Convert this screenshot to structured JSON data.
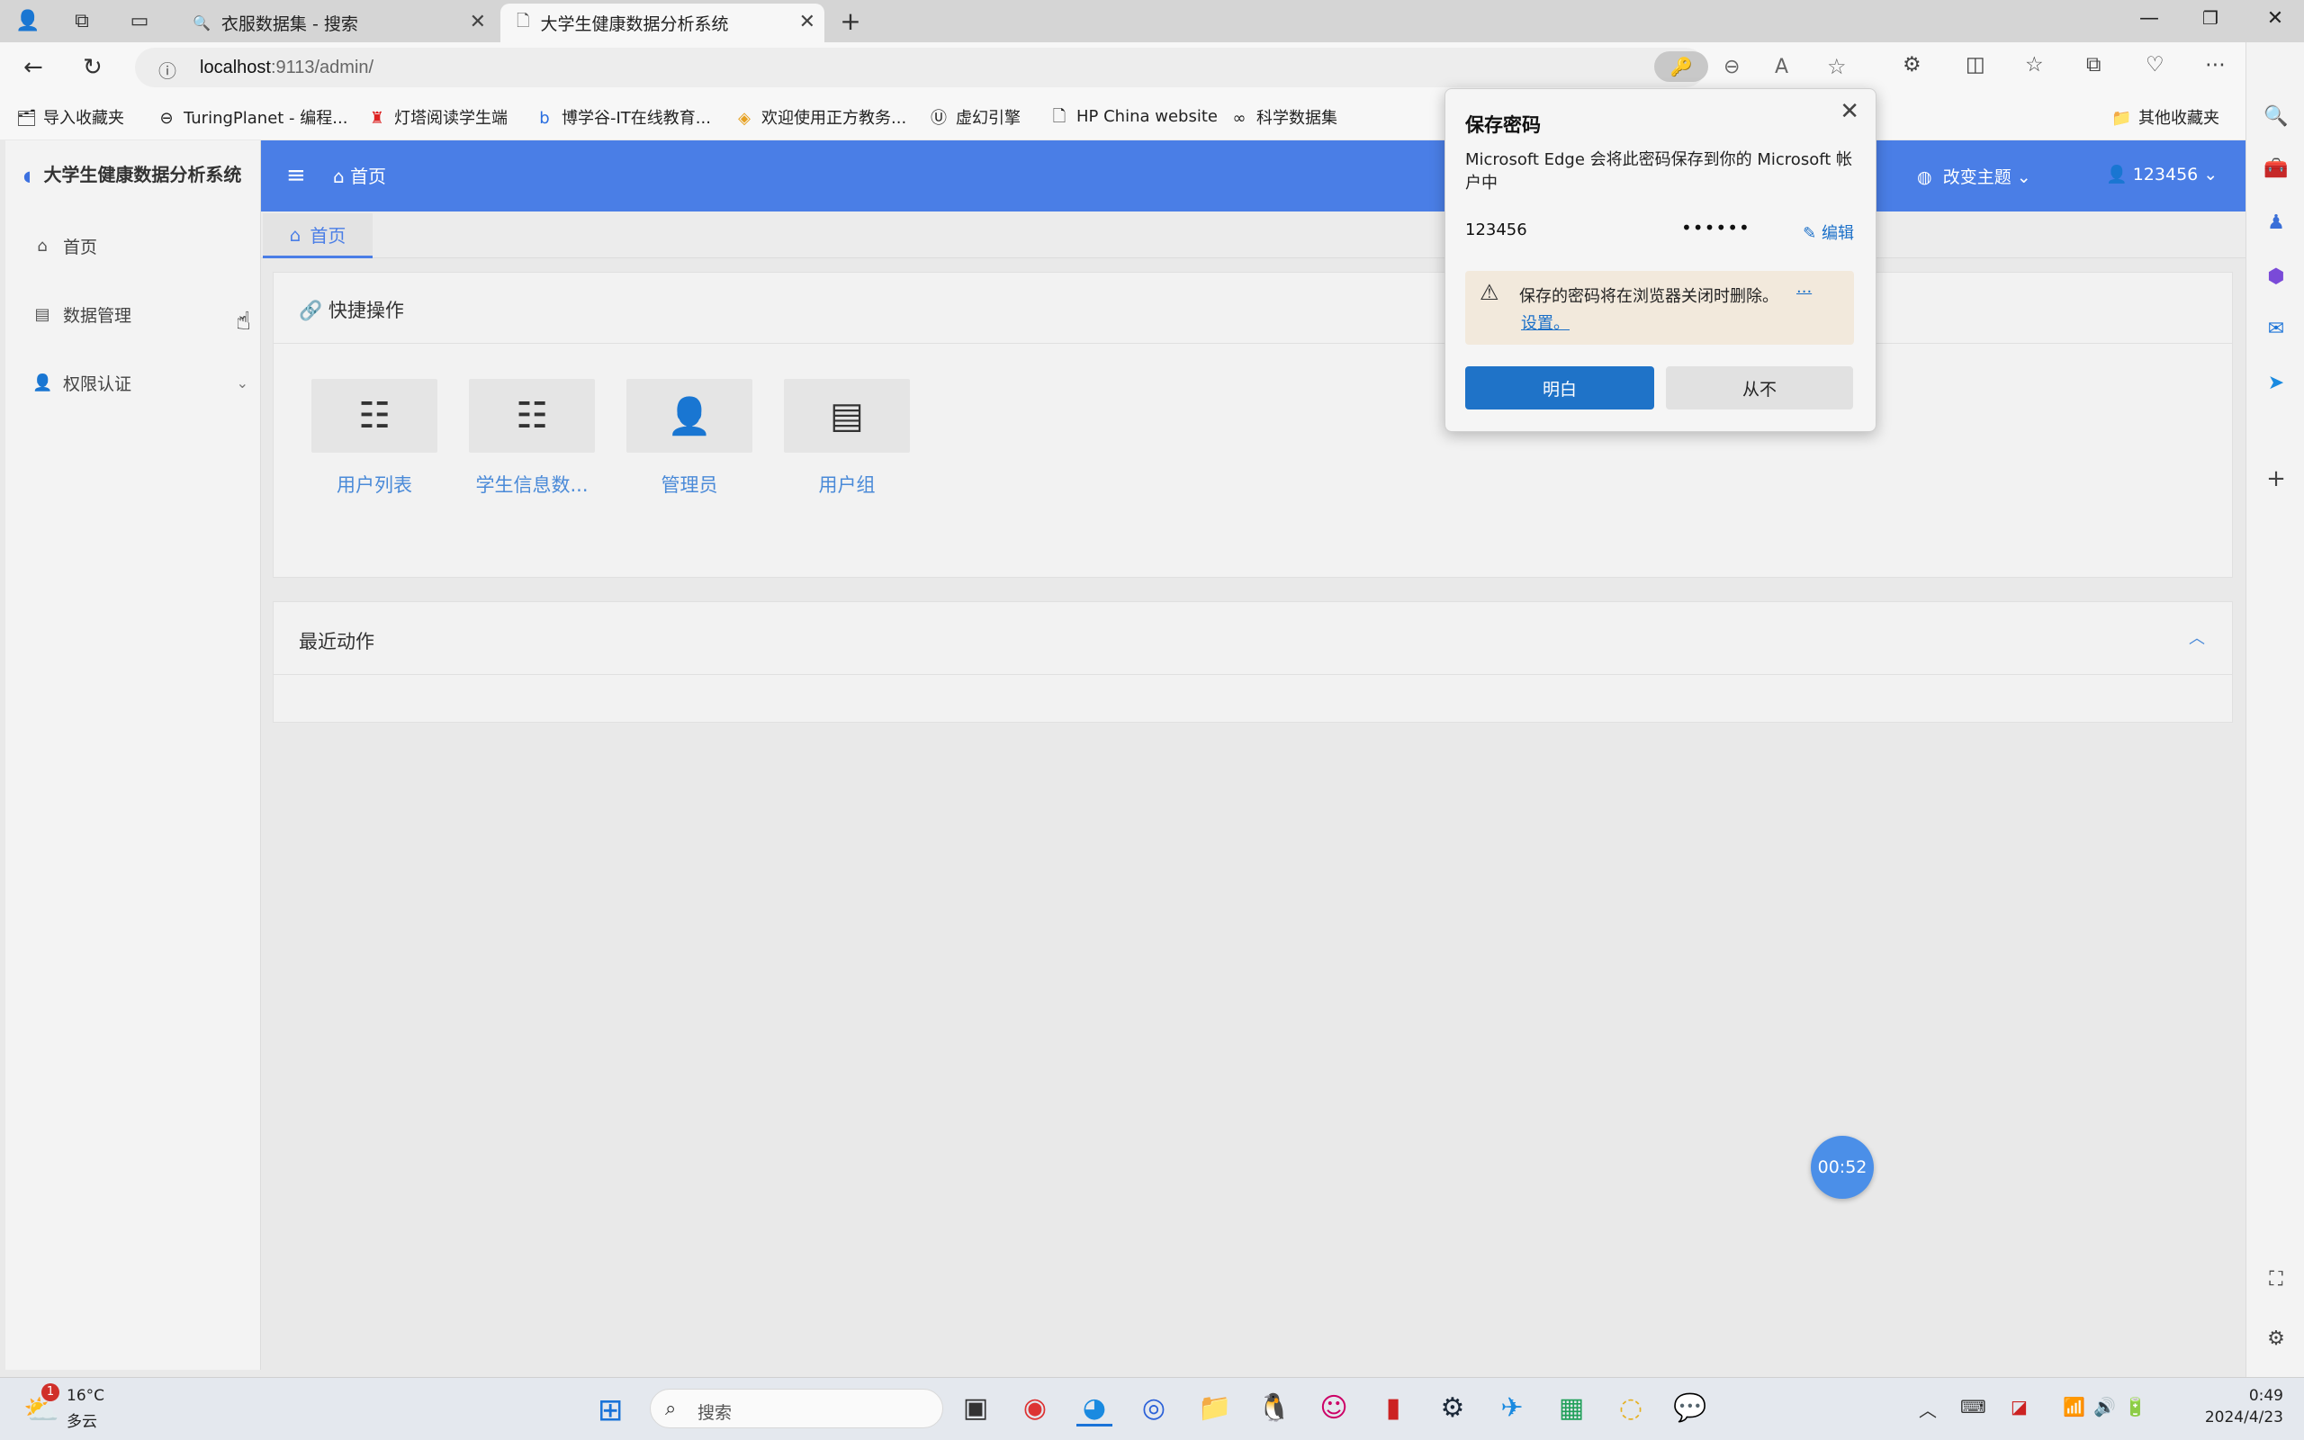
{
  "browser": {
    "tabs": [
      {
        "title": "衣服数据集 - 搜索",
        "icon": "search-icon"
      },
      {
        "title": "大学生健康数据分析系统",
        "icon": "page-icon",
        "active": true
      }
    ],
    "url_host": "localhost",
    "url_rest": ":9113/admin/"
  },
  "bookmarks": [
    {
      "label": "导入收藏夹",
      "icon": "import-icon"
    },
    {
      "label": "TuringPlanet - 编程...",
      "icon": "turing-icon"
    },
    {
      "label": "灯塔阅读学生端",
      "icon": "tower-icon"
    },
    {
      "label": "博学谷-IT在线教育...",
      "icon": "boxuegu-icon"
    },
    {
      "label": "欢迎使用正方教务...",
      "icon": "zhengfang-icon"
    },
    {
      "label": "虚幻引擎",
      "icon": "unreal-icon"
    },
    {
      "label": "HP China website",
      "icon": "page-icon"
    },
    {
      "label": "科学数据集",
      "icon": "infinity-icon"
    },
    {
      "label": "其他收藏夹",
      "icon": "folder-icon"
    }
  ],
  "app": {
    "brand": "大学生健康数据分析系统",
    "menu": [
      {
        "label": "首页",
        "icon": "home-icon"
      },
      {
        "label": "数据管理",
        "icon": "table-icon",
        "has_children": true
      },
      {
        "label": "权限认证",
        "icon": "user-lock-icon",
        "has_children": true
      }
    ],
    "header": {
      "home": "首页",
      "theme": "改变主题",
      "user": "123456"
    },
    "tab_home": "首页",
    "quick": {
      "title": "快捷操作",
      "items": [
        {
          "label": "用户列表",
          "icon": "checklist-icon"
        },
        {
          "label": "学生信息数...",
          "icon": "checklist-icon"
        },
        {
          "label": "管理员",
          "icon": "user-icon"
        },
        {
          "label": "用户组",
          "icon": "list-icon"
        }
      ]
    },
    "recent": {
      "title": "最近动作"
    },
    "timer": "00:52"
  },
  "password_popup": {
    "title": "保存密码",
    "description": "Microsoft Edge 会将此密码保存到你的 Microsoft 帐户中",
    "username": "123456",
    "password_mask": "••••••",
    "edit": "编辑",
    "warning": "保存的密码将在浏览器关闭时删除。",
    "warning_more": "...",
    "warning_link": "设置。",
    "accept": "明白",
    "never": "从不"
  },
  "taskbar": {
    "weather_badge": "1",
    "temperature": "16°C",
    "weather": "多云",
    "search_placeholder": "搜索",
    "time": "0:49",
    "date": "2024/4/23"
  }
}
